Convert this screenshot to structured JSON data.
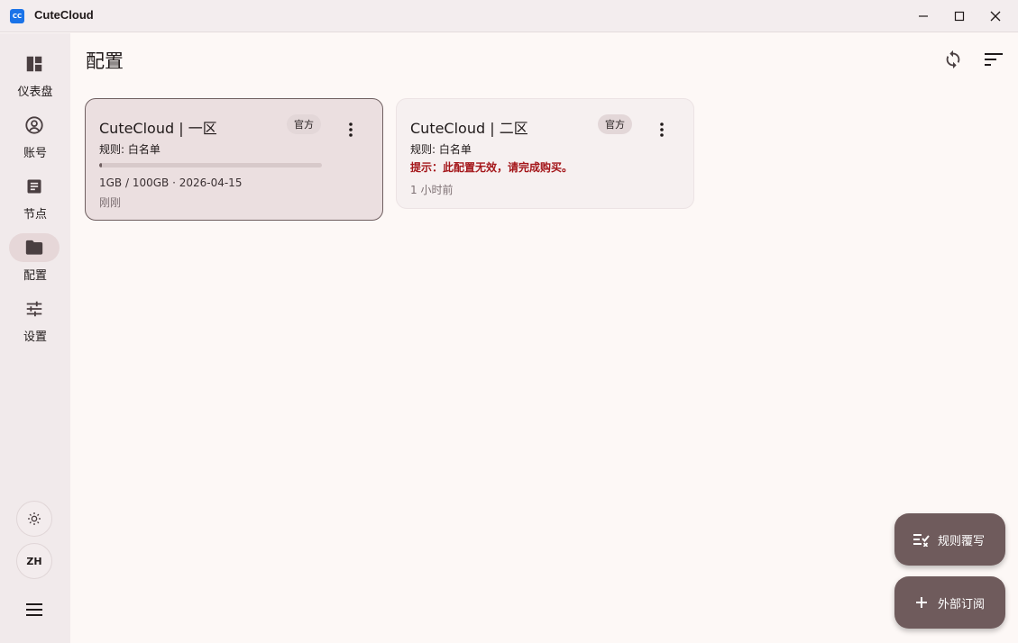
{
  "app": {
    "logo_text": "CC",
    "title": "CuteCloud"
  },
  "sidebar": {
    "items": [
      {
        "label": "仪表盘",
        "icon": "dashboard-icon"
      },
      {
        "label": "账号",
        "icon": "account-icon"
      },
      {
        "label": "节点",
        "icon": "nodes-icon"
      },
      {
        "label": "配置",
        "icon": "folder-icon",
        "active": true
      },
      {
        "label": "设置",
        "icon": "tune-icon"
      }
    ],
    "theme_icon": "brightness-icon",
    "language": "ZH",
    "menu_icon": "menu-icon"
  },
  "header": {
    "title": "配置",
    "refresh_icon": "sync-icon",
    "sort_icon": "sort-icon"
  },
  "profiles": [
    {
      "name": "CuteCloud | 一区",
      "badge": "官方",
      "rule": "规则: 白名单",
      "usage_fraction": 0.01,
      "usage": "1GB / 100GB · 2026-04-15",
      "updated": "刚刚",
      "selected": true
    },
    {
      "name": "CuteCloud | 二区",
      "badge": "官方",
      "rule": "规则: 白名单",
      "warning": "提示：此配置无效，请完成购买。",
      "updated": "1 小时前",
      "selected": false
    }
  ],
  "fabs": {
    "rules_override": "规则覆写",
    "external_sub": "外部订阅"
  },
  "colors": {
    "accent": "#6f5b5c",
    "warning": "#a4161a",
    "background": "#fdf8f6",
    "sidebar": "#f1eaeb"
  }
}
